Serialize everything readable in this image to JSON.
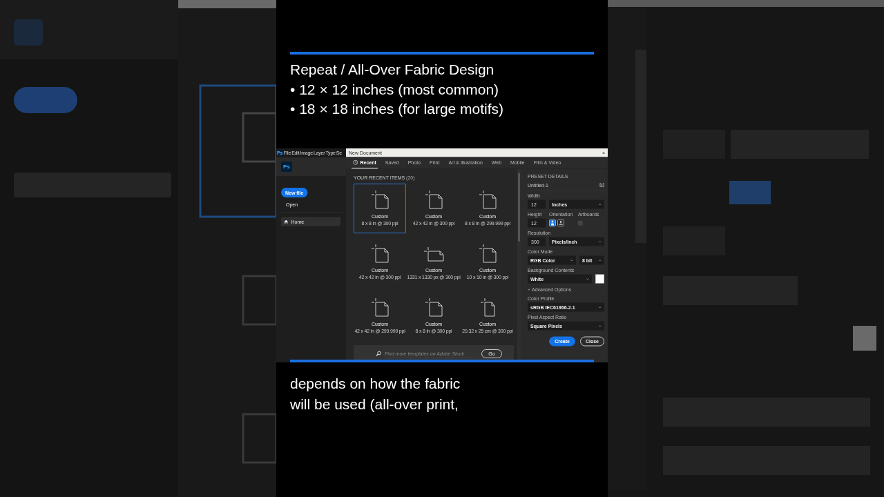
{
  "caption_top": {
    "lines": [
      "Repeat / All-Over Fabric Design",
      "• 12 × 12 inches (most common)",
      "• 18 × 18 inches (for large motifs)"
    ]
  },
  "screenshot": {
    "menu_bar": {
      "logo": "Ps",
      "items": [
        "File",
        "Edit",
        "Image",
        "Layer",
        "Type",
        "Se"
      ]
    },
    "home": {
      "logo": "Ps",
      "new_file": "New file",
      "open": "Open",
      "nav": [
        {
          "label": "Home",
          "selected": true
        }
      ]
    },
    "dialog": {
      "title": "New Document",
      "close_glyph": "×",
      "tabs": [
        {
          "label": "Recent",
          "selected": true
        },
        {
          "label": "Saved",
          "selected": false
        },
        {
          "label": "Photo",
          "selected": false
        },
        {
          "label": "Print",
          "selected": false
        },
        {
          "label": "Art & Illustration",
          "selected": false
        },
        {
          "label": "Web",
          "selected": false
        },
        {
          "label": "Mobile",
          "selected": false
        },
        {
          "label": "Film & Video",
          "selected": false
        }
      ],
      "section_title": "YOUR RECENT ITEMS",
      "count": "(20)",
      "items": [
        {
          "name": "Custom",
          "size": "8 x 8 in @ 300 ppi",
          "kind": "square",
          "selected": true
        },
        {
          "name": "Custom",
          "size": "42 x 42 in @ 300 ppi",
          "kind": "square",
          "selected": false
        },
        {
          "name": "Custom",
          "size": "8 x 8 in @ 299.999 ppi",
          "kind": "square",
          "selected": false
        },
        {
          "name": "Custom",
          "size": "42 x 42 in @ 300 ppi",
          "kind": "square",
          "selected": false
        },
        {
          "name": "Custom",
          "size": "1331 x 1330 px @ 300 ppi",
          "kind": "wide",
          "selected": false
        },
        {
          "name": "Custom",
          "size": "10 x 10 in @ 300 ppi",
          "kind": "square",
          "selected": false
        },
        {
          "name": "Custom",
          "size": "42 x 42 in @ 299.999 ppi",
          "kind": "square",
          "selected": false
        },
        {
          "name": "Custom",
          "size": "8 x 8 in @ 300 ppi",
          "kind": "square",
          "selected": false
        },
        {
          "name": "Custom",
          "size": "20.32 x 25 cm @ 300 ppi",
          "kind": "tall",
          "selected": false
        }
      ],
      "search": {
        "placeholder": "Find more templates on Adobe Stock",
        "button": "Go"
      },
      "preset": {
        "heading": "PRESET DETAILS",
        "name": "Untitled-1",
        "width": {
          "label": "Width",
          "value": "12",
          "unit": "Inches"
        },
        "height": {
          "label": "Height",
          "value": "12"
        },
        "orientation": {
          "label": "Orientation",
          "options": [
            {
              "kind": "portrait",
              "selected": true
            },
            {
              "kind": "landscape",
              "selected": false
            }
          ]
        },
        "artboards": {
          "label": "Artboards",
          "checked": false
        },
        "resolution": {
          "label": "Resolution",
          "value": "300",
          "unit": "Pixels/Inch"
        },
        "color_mode": {
          "label": "Color Mode",
          "mode": "RGB Color",
          "depth": "8 bit"
        },
        "background": {
          "label": "Background Contents",
          "value": "White",
          "color": "#ffffff"
        },
        "advanced": {
          "label": "Advanced Options",
          "expanded": true
        },
        "color_profile": {
          "label": "Color Profile",
          "value": "sRGB IEC61966-2.1"
        },
        "pixel_aspect": {
          "label": "Pixel Aspect Ratio",
          "value": "Square Pixels"
        },
        "buttons": [
          {
            "label": "Create",
            "kind": "primary"
          },
          {
            "label": "Close",
            "kind": "secondary"
          }
        ]
      }
    }
  },
  "caption_bottom": {
    "lines": [
      "depends on how the fabric",
      "will be used (all-over print,"
    ]
  }
}
